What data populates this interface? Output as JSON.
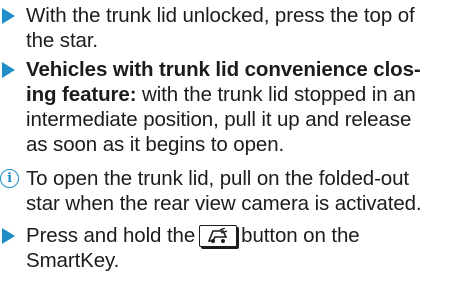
{
  "items": [
    {
      "type": "step",
      "lines": [
        "With the trunk lid unlocked, press the top of",
        "the star."
      ]
    },
    {
      "type": "step",
      "bold_lines": [
        "Vehicles with trunk lid convenience clos-",
        "ing feature:"
      ],
      "lines": [
        " with the trunk lid stopped in an",
        "intermediate position, pull it up and release",
        "as soon as it begins to open."
      ]
    },
    {
      "type": "note",
      "lines": [
        "To open the trunk lid, pull on the folded-out",
        "star when the rear view camera is activated."
      ]
    },
    {
      "type": "step",
      "before_key": "Press and hold the",
      "key_icon": "trunk-open-icon",
      "after_key": "button on the",
      "line2": "SmartKey."
    }
  ],
  "colors": {
    "accent": "#1e8fc9",
    "text": "#1c1c1c"
  }
}
